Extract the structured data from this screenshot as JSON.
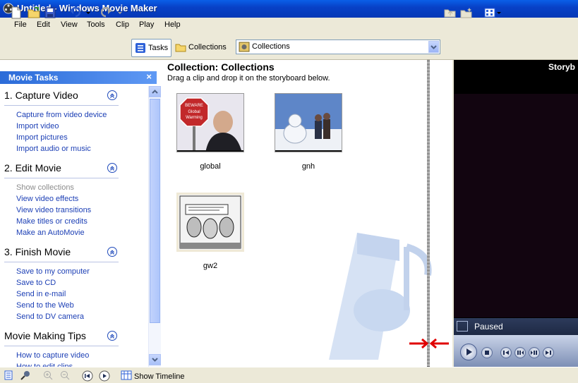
{
  "window": {
    "title": "Untitled - Windows Movie Maker"
  },
  "menu": [
    "File",
    "Edit",
    "View",
    "Tools",
    "Clip",
    "Play",
    "Help"
  ],
  "toolbar": {
    "tasks_label": "Tasks",
    "collections_label": "Collections",
    "collection_select_value": "Collections"
  },
  "tasks_pane": {
    "header": "Movie Tasks",
    "close": "×",
    "sections": [
      {
        "title": "1. Capture Video",
        "items": [
          "Capture from video device",
          "Import video",
          "Import pictures",
          "Import audio or music"
        ]
      },
      {
        "title": "2. Edit Movie",
        "items": [
          "Show collections",
          "View video effects",
          "View video transitions",
          "Make titles or credits",
          "Make an AutoMovie"
        ]
      },
      {
        "title": "3. Finish Movie",
        "items": [
          "Save to my computer",
          "Save to CD",
          "Send in e-mail",
          "Send to the Web",
          "Send to DV camera"
        ]
      },
      {
        "title": "Movie Making Tips",
        "items": [
          "How to capture video",
          "How to edit clips"
        ]
      }
    ]
  },
  "collection": {
    "title": "Collection: Collections",
    "subtitle": "Drag a clip and drop it on the storyboard below.",
    "clips": [
      {
        "name": "global",
        "sign_text_1": "BEWARE",
        "sign_text_2": "Global",
        "sign_text_3": "Warming"
      },
      {
        "name": "gnh"
      },
      {
        "name": "gw2"
      }
    ]
  },
  "preview": {
    "label": "Storyb",
    "status": "Paused"
  },
  "bottom": {
    "show_timeline_label": "Show Timeline"
  },
  "colors": {
    "title_bar": "#0A5FE8",
    "task_header": "#2B6BD8",
    "link": "#1C3FB5",
    "arrow": "#E00000"
  }
}
